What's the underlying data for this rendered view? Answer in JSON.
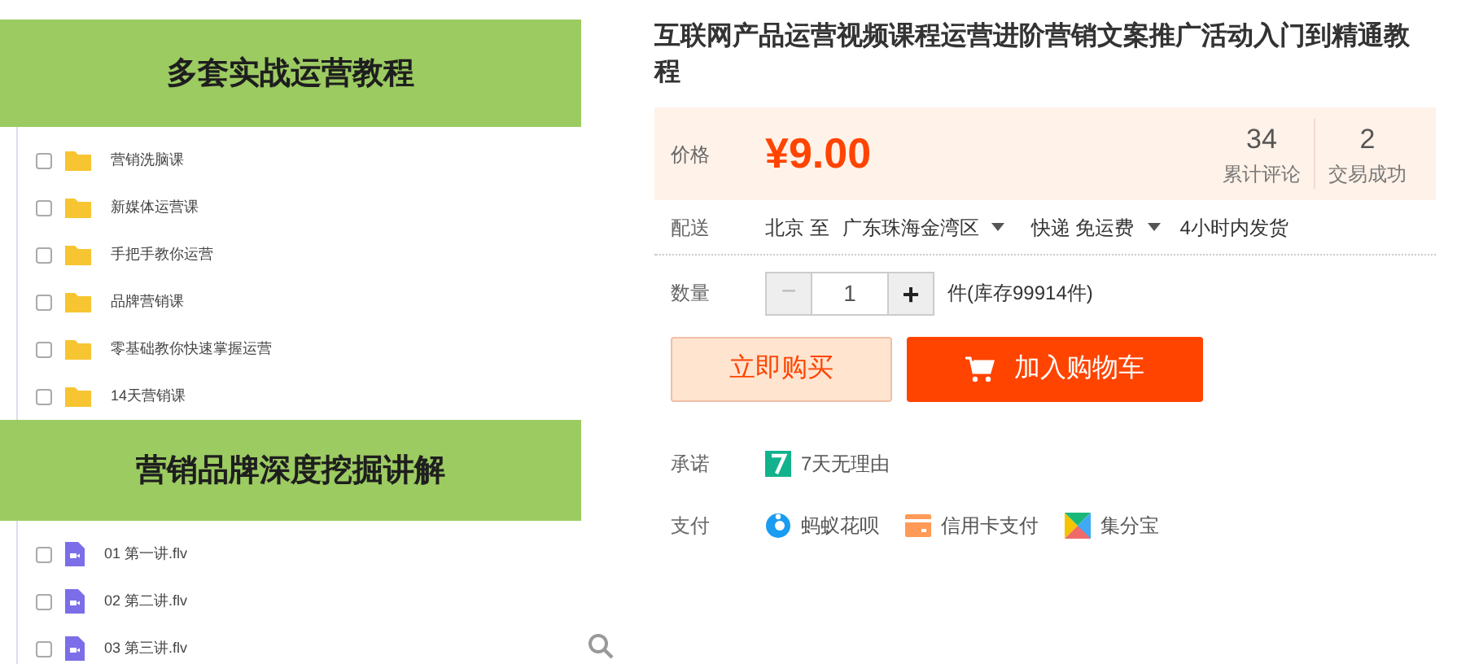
{
  "product_image": {
    "sections": [
      {
        "title": "多套实战运营教程",
        "items": [
          {
            "kind": "folder",
            "name": "营销洗脑课",
            "checked": false
          },
          {
            "kind": "folder",
            "name": "新媒体运营课",
            "checked": false
          },
          {
            "kind": "folder",
            "name": "手把手教你运营",
            "checked": false
          },
          {
            "kind": "folder",
            "name": "品牌营销课",
            "checked": false
          },
          {
            "kind": "folder",
            "name": "零基础教你快速掌握运营",
            "checked": false
          },
          {
            "kind": "folder",
            "name": "14天营销课",
            "checked": false
          }
        ]
      },
      {
        "title": "营销品牌深度挖掘讲解",
        "items": [
          {
            "kind": "video",
            "name": "01 第一讲.flv",
            "checked": false
          },
          {
            "kind": "video",
            "name": "02 第二讲.flv",
            "checked": false
          },
          {
            "kind": "video",
            "name": "03 第三讲.flv",
            "checked": false
          }
        ]
      }
    ]
  },
  "title": "互联网产品运营视频课程运营进阶营销文案推广活动入门到精通教程",
  "price": {
    "label": "价格",
    "value": "¥9.00",
    "stats": [
      {
        "value": "34",
        "label": "累计评论"
      },
      {
        "value": "2",
        "label": "交易成功"
      }
    ]
  },
  "delivery": {
    "label": "配送",
    "from": "北京 至",
    "to": "广东珠海金湾区",
    "shipping": "快递 免运费",
    "time": "4小时内发货"
  },
  "quantity": {
    "label": "数量",
    "minus": "−",
    "value": "1",
    "plus": "+",
    "stock": "件(库存99914件)"
  },
  "buttons": {
    "buy_now": "立即购买",
    "add_to_cart": "加入购物车"
  },
  "promise": {
    "label": "承诺",
    "items": [
      {
        "kind": "seven",
        "text": "7天无理由"
      }
    ]
  },
  "payment": {
    "label": "支付",
    "items": [
      {
        "kind": "huabei",
        "text": "蚂蚁花呗"
      },
      {
        "kind": "card",
        "text": "信用卡支付"
      },
      {
        "kind": "jifen",
        "text": "集分宝"
      }
    ]
  }
}
